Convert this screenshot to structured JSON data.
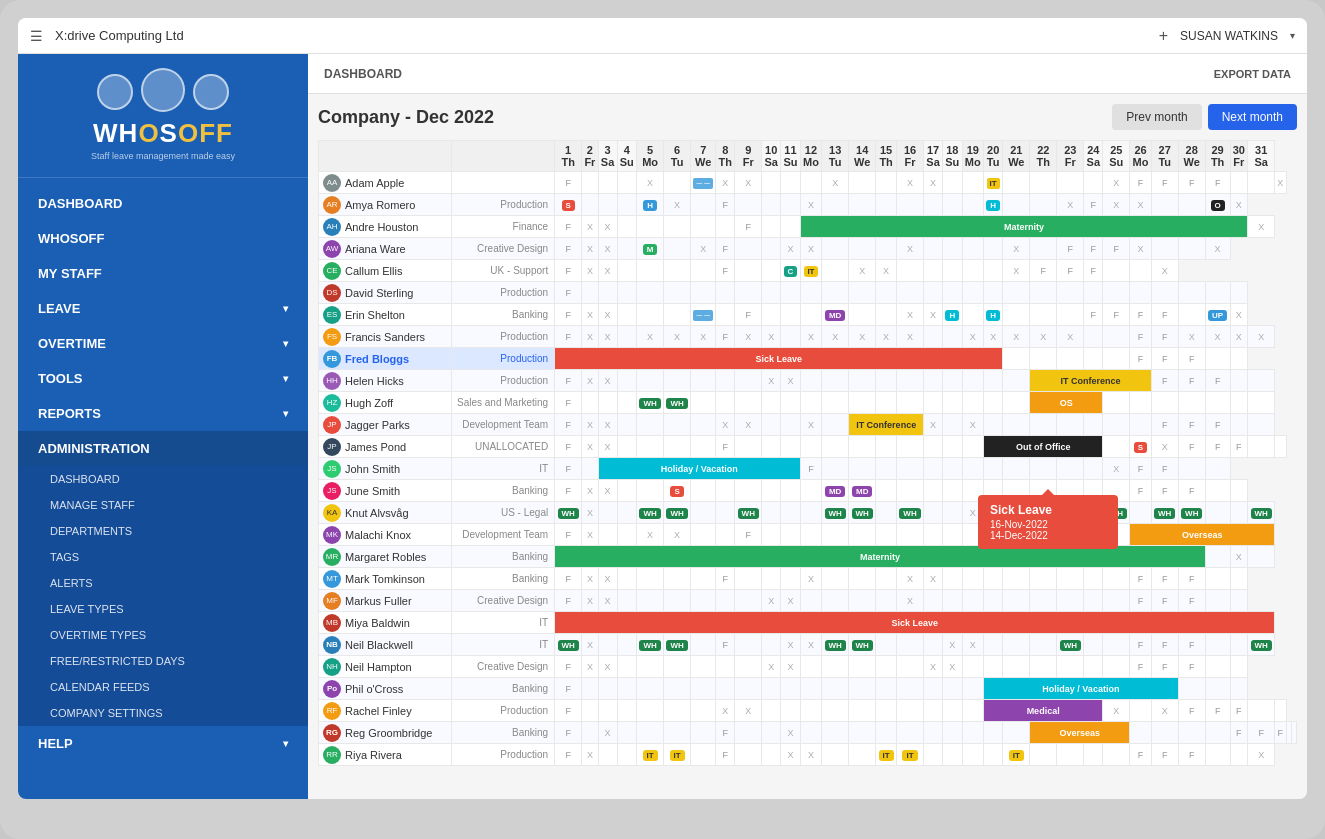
{
  "topBar": {
    "title": "X:drive Computing Ltd",
    "plusLabel": "+",
    "userLabel": "SUSAN WATKINS",
    "chevron": "▾"
  },
  "sidebar": {
    "logoSubtext": "Staff leave management made easy",
    "navItems": [
      {
        "id": "dashboard",
        "label": "DASHBOARD",
        "hasArrow": false
      },
      {
        "id": "whosoff",
        "label": "WHOSOFF",
        "hasArrow": false
      },
      {
        "id": "mystaff",
        "label": "MY STAFF",
        "hasArrow": false
      },
      {
        "id": "leave",
        "label": "LEAVE",
        "hasArrow": true
      },
      {
        "id": "overtime",
        "label": "OVERTIME",
        "hasArrow": true
      },
      {
        "id": "tools",
        "label": "TOOLS",
        "hasArrow": true
      },
      {
        "id": "reports",
        "label": "REPORTS",
        "hasArrow": true
      },
      {
        "id": "administration",
        "label": "ADMINISTRATION",
        "hasArrow": false
      }
    ],
    "adminSubItems": [
      "DASHBOARD",
      "MANAGE STAFF",
      "DEPARTMENTS",
      "TAGS",
      "ALERTS",
      "LEAVE TYPES",
      "OVERTIME TYPES",
      "FREE/RESTRICTED DAYS",
      "CALENDAR FEEDS",
      "COMPANY SETTINGS"
    ],
    "helpItem": "HELP"
  },
  "content": {
    "headerTitle": "DASHBOARD",
    "exportLabel": "EXPORT DATA",
    "calendarTitle": "Company - Dec 2022",
    "prevBtn": "Prev month",
    "nextBtn": "Next month"
  },
  "calendar": {
    "days": [
      {
        "num": "1",
        "name": "Th"
      },
      {
        "num": "2",
        "name": "Fr"
      },
      {
        "num": "3",
        "name": "Sa"
      },
      {
        "num": "4",
        "name": "Su"
      },
      {
        "num": "5",
        "name": "Mo"
      },
      {
        "num": "6",
        "name": "Tu"
      },
      {
        "num": "7",
        "name": "We"
      },
      {
        "num": "8",
        "name": "Th"
      },
      {
        "num": "9",
        "name": "Fr"
      },
      {
        "num": "10",
        "name": "Sa"
      },
      {
        "num": "11",
        "name": "Su"
      },
      {
        "num": "12",
        "name": "Mo"
      },
      {
        "num": "13",
        "name": "Tu"
      },
      {
        "num": "14",
        "name": "We"
      },
      {
        "num": "15",
        "name": "Th"
      },
      {
        "num": "16",
        "name": "Fr"
      },
      {
        "num": "17",
        "name": "Sa"
      },
      {
        "num": "18",
        "name": "Su"
      },
      {
        "num": "19",
        "name": "Mo"
      },
      {
        "num": "20",
        "name": "Tu"
      },
      {
        "num": "21",
        "name": "We"
      },
      {
        "num": "22",
        "name": "Th"
      },
      {
        "num": "23",
        "name": "Fr"
      },
      {
        "num": "24",
        "name": "Sa"
      },
      {
        "num": "25",
        "name": "Su"
      },
      {
        "num": "26",
        "name": "Mo"
      },
      {
        "num": "27",
        "name": "Tu"
      },
      {
        "num": "28",
        "name": "We"
      },
      {
        "num": "29",
        "name": "Th"
      },
      {
        "num": "30",
        "name": "Fr"
      },
      {
        "num": "31",
        "name": "Sa"
      }
    ],
    "tooltip": {
      "title": "Sick Leave",
      "line1": "16-Nov-2022",
      "line2": "14-Dec-2022"
    },
    "employees": [
      {
        "name": "Adam Apple",
        "dept": "",
        "avatar": "#7f8c8d",
        "initials": "AA"
      },
      {
        "name": "Amya Romero",
        "dept": "Production",
        "avatar": "#e67e22",
        "initials": "AR"
      },
      {
        "name": "Andre Houston",
        "dept": "Finance",
        "avatar": "#2980b9",
        "initials": "AH"
      },
      {
        "name": "Ariana Ware",
        "dept": "Creative Design",
        "avatar": "#8e44ad",
        "initials": "AW"
      },
      {
        "name": "Callum Ellis",
        "dept": "UK - Support",
        "avatar": "#27ae60",
        "initials": "CE"
      },
      {
        "name": "David Sterling",
        "dept": "Production",
        "avatar": "#c0392b",
        "initials": "DS"
      },
      {
        "name": "Erin Shelton",
        "dept": "Banking",
        "avatar": "#16a085",
        "initials": "ES"
      },
      {
        "name": "Francis Sanders",
        "dept": "Production",
        "avatar": "#f39c12",
        "initials": "FS"
      },
      {
        "name": "Fred Bloggs",
        "dept": "Production",
        "avatar": "#3498db",
        "initials": "FB",
        "highlight": true
      },
      {
        "name": "Helen Hicks",
        "dept": "Production",
        "avatar": "#9b59b6",
        "initials": "HH"
      },
      {
        "name": "Hugh Zoff",
        "dept": "Sales and Marketing",
        "avatar": "#1abc9c",
        "initials": "HZ"
      },
      {
        "name": "Jagger Parks",
        "dept": "Development Team",
        "avatar": "#e74c3c",
        "initials": "JP"
      },
      {
        "name": "James Pond",
        "dept": "UNALLOCATED",
        "avatar": "#34495e",
        "initials": "JP2"
      },
      {
        "name": "John Smith",
        "dept": "IT",
        "avatar": "#2ecc71",
        "initials": "JS"
      },
      {
        "name": "June Smith",
        "dept": "Banking",
        "avatar": "#e91e63",
        "initials": "JS2"
      },
      {
        "name": "Knut Alvsvåg",
        "dept": "US - Legal",
        "avatar": "#f1c40f",
        "initials": "KA"
      },
      {
        "name": "Malachi Knox",
        "dept": "Development Team",
        "avatar": "#8e44ad",
        "initials": "MK"
      },
      {
        "name": "Margaret Robles",
        "dept": "Banking",
        "avatar": "#27ae60",
        "initials": "MR"
      },
      {
        "name": "Mark Tomkinson",
        "dept": "Banking",
        "avatar": "#3498db",
        "initials": "MT"
      },
      {
        "name": "Markus Fuller",
        "dept": "Creative Design",
        "avatar": "#e67e22",
        "initials": "MF"
      },
      {
        "name": "Miya Baldwin",
        "dept": "IT",
        "avatar": "#c0392b",
        "initials": "MB"
      },
      {
        "name": "Neil Blackwell",
        "dept": "IT",
        "avatar": "#2980b9",
        "initials": "NB",
        "initials_badge": true
      },
      {
        "name": "Neil Hampton",
        "dept": "Creative Design",
        "avatar": "#16a085",
        "initials": "NH"
      },
      {
        "name": "Phil o'Cross",
        "dept": "Banking",
        "avatar": "#8e44ad",
        "initials": "Po",
        "initials_badge": true
      },
      {
        "name": "Rachel Finley",
        "dept": "Production",
        "avatar": "#f39c12",
        "initials": "RF"
      },
      {
        "name": "Reg Groombridge",
        "dept": "Banking",
        "avatar": "#c0392b",
        "initials": "RG",
        "initials_badge": true
      },
      {
        "name": "Riya Rivera",
        "dept": "Production",
        "avatar": "#27ae60",
        "initials": "RR"
      }
    ]
  }
}
